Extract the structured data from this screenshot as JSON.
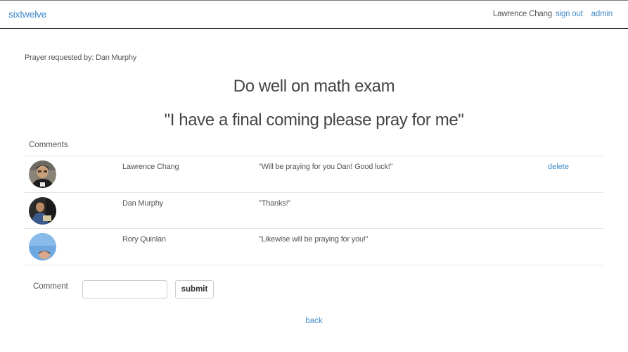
{
  "navbar": {
    "brand": "sixtwelve",
    "user_name": "Lawrence Chang",
    "sign_out": "sign out",
    "admin": "admin"
  },
  "prayer": {
    "requested_label": "Prayer requested by:",
    "requested_by": "Dan Murphy",
    "title": "Do well on math exam",
    "quote": "\"I have a final coming please pray for me\""
  },
  "comments": {
    "header": "Comments",
    "rows": [
      {
        "author": "Lawrence Chang",
        "text": "\"Will be praying for you Dan! Good luck!\"",
        "action": "delete"
      },
      {
        "author": "Dan Murphy",
        "text": "\"Thanks!\"",
        "action": ""
      },
      {
        "author": "Rory Quinlan",
        "text": "\"Likewise will be praying for you!\"",
        "action": ""
      }
    ]
  },
  "form": {
    "label": "Comment",
    "input_value": "",
    "input_placeholder": "",
    "submit": "submit"
  },
  "footer": {
    "back": "back"
  },
  "colors": {
    "link": "#428bca",
    "text": "#555555"
  }
}
